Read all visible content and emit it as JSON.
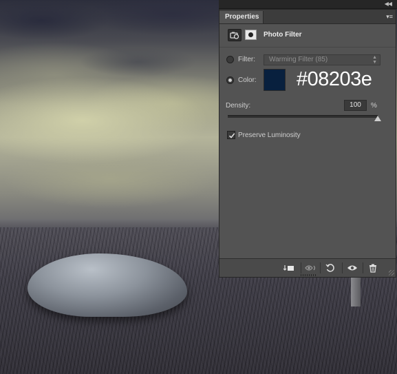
{
  "panel": {
    "tab_label": "Properties",
    "title": "Photo Filter",
    "filter": {
      "label": "Filter:",
      "selected": "Warming Filter (85)",
      "checked": false
    },
    "color": {
      "label": "Color:",
      "swatch": "#08203e",
      "hex_text": "#08203e",
      "checked": true
    },
    "density": {
      "label": "Density:",
      "value": "100",
      "unit": "%",
      "level": 1.0
    },
    "preserve_luminosity": {
      "label": "Preserve Luminosity",
      "checked": true
    },
    "footer_buttons": [
      "clip-to-layer-icon",
      "view-previous-state-icon",
      "reset-icon",
      "visibility-eye-icon",
      "trash-icon"
    ]
  },
  "colors": {
    "panel_bg": "#535353",
    "panel_dark": "#3c3c3c",
    "text": "#cfcfcf",
    "swatch": "#08203e"
  }
}
